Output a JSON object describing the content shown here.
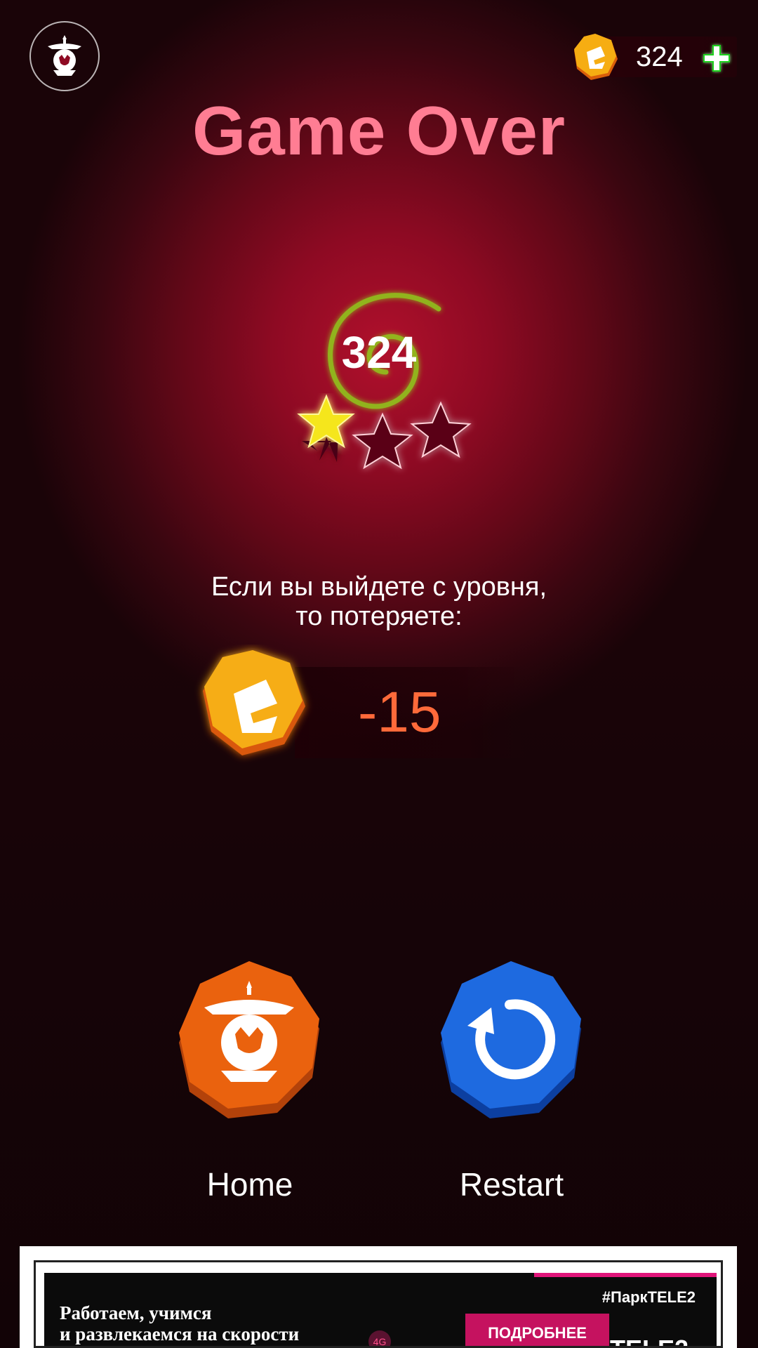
{
  "header": {
    "settings_icon": "lantern-icon",
    "coin_icon": "coin-icon",
    "coin_balance": "324",
    "add_coins_icon": "plus-icon"
  },
  "title": "Game Over",
  "result": {
    "score": "324",
    "stars_earned": 1,
    "stars_total": 3
  },
  "warning": {
    "line1": "Если вы выйдете с уровня,",
    "line2": "то потеряете:"
  },
  "penalty": {
    "coin_icon": "coin-icon",
    "value": "-15"
  },
  "buttons": {
    "home": {
      "icon": "lantern-icon",
      "label": "Home"
    },
    "restart": {
      "icon": "restart-icon",
      "label": "Restart"
    }
  },
  "ad": {
    "hashtag": "#ПаркTELE2",
    "line1": "Работаем, учимся",
    "line2": "и развлекаемся на скорости",
    "badge": "4G",
    "cta": "ПОДРОБНЕЕ",
    "logo": "TELE2"
  },
  "colors": {
    "title": "#ff7d93",
    "penalty": "#ff6a3a",
    "home_button": "#e8600e",
    "restart_button": "#1e6ae0",
    "star_active": "#f5e61a",
    "spiral": "#8fd11a",
    "plus": "#1fd11f",
    "ad_cta": "#c5125f"
  }
}
